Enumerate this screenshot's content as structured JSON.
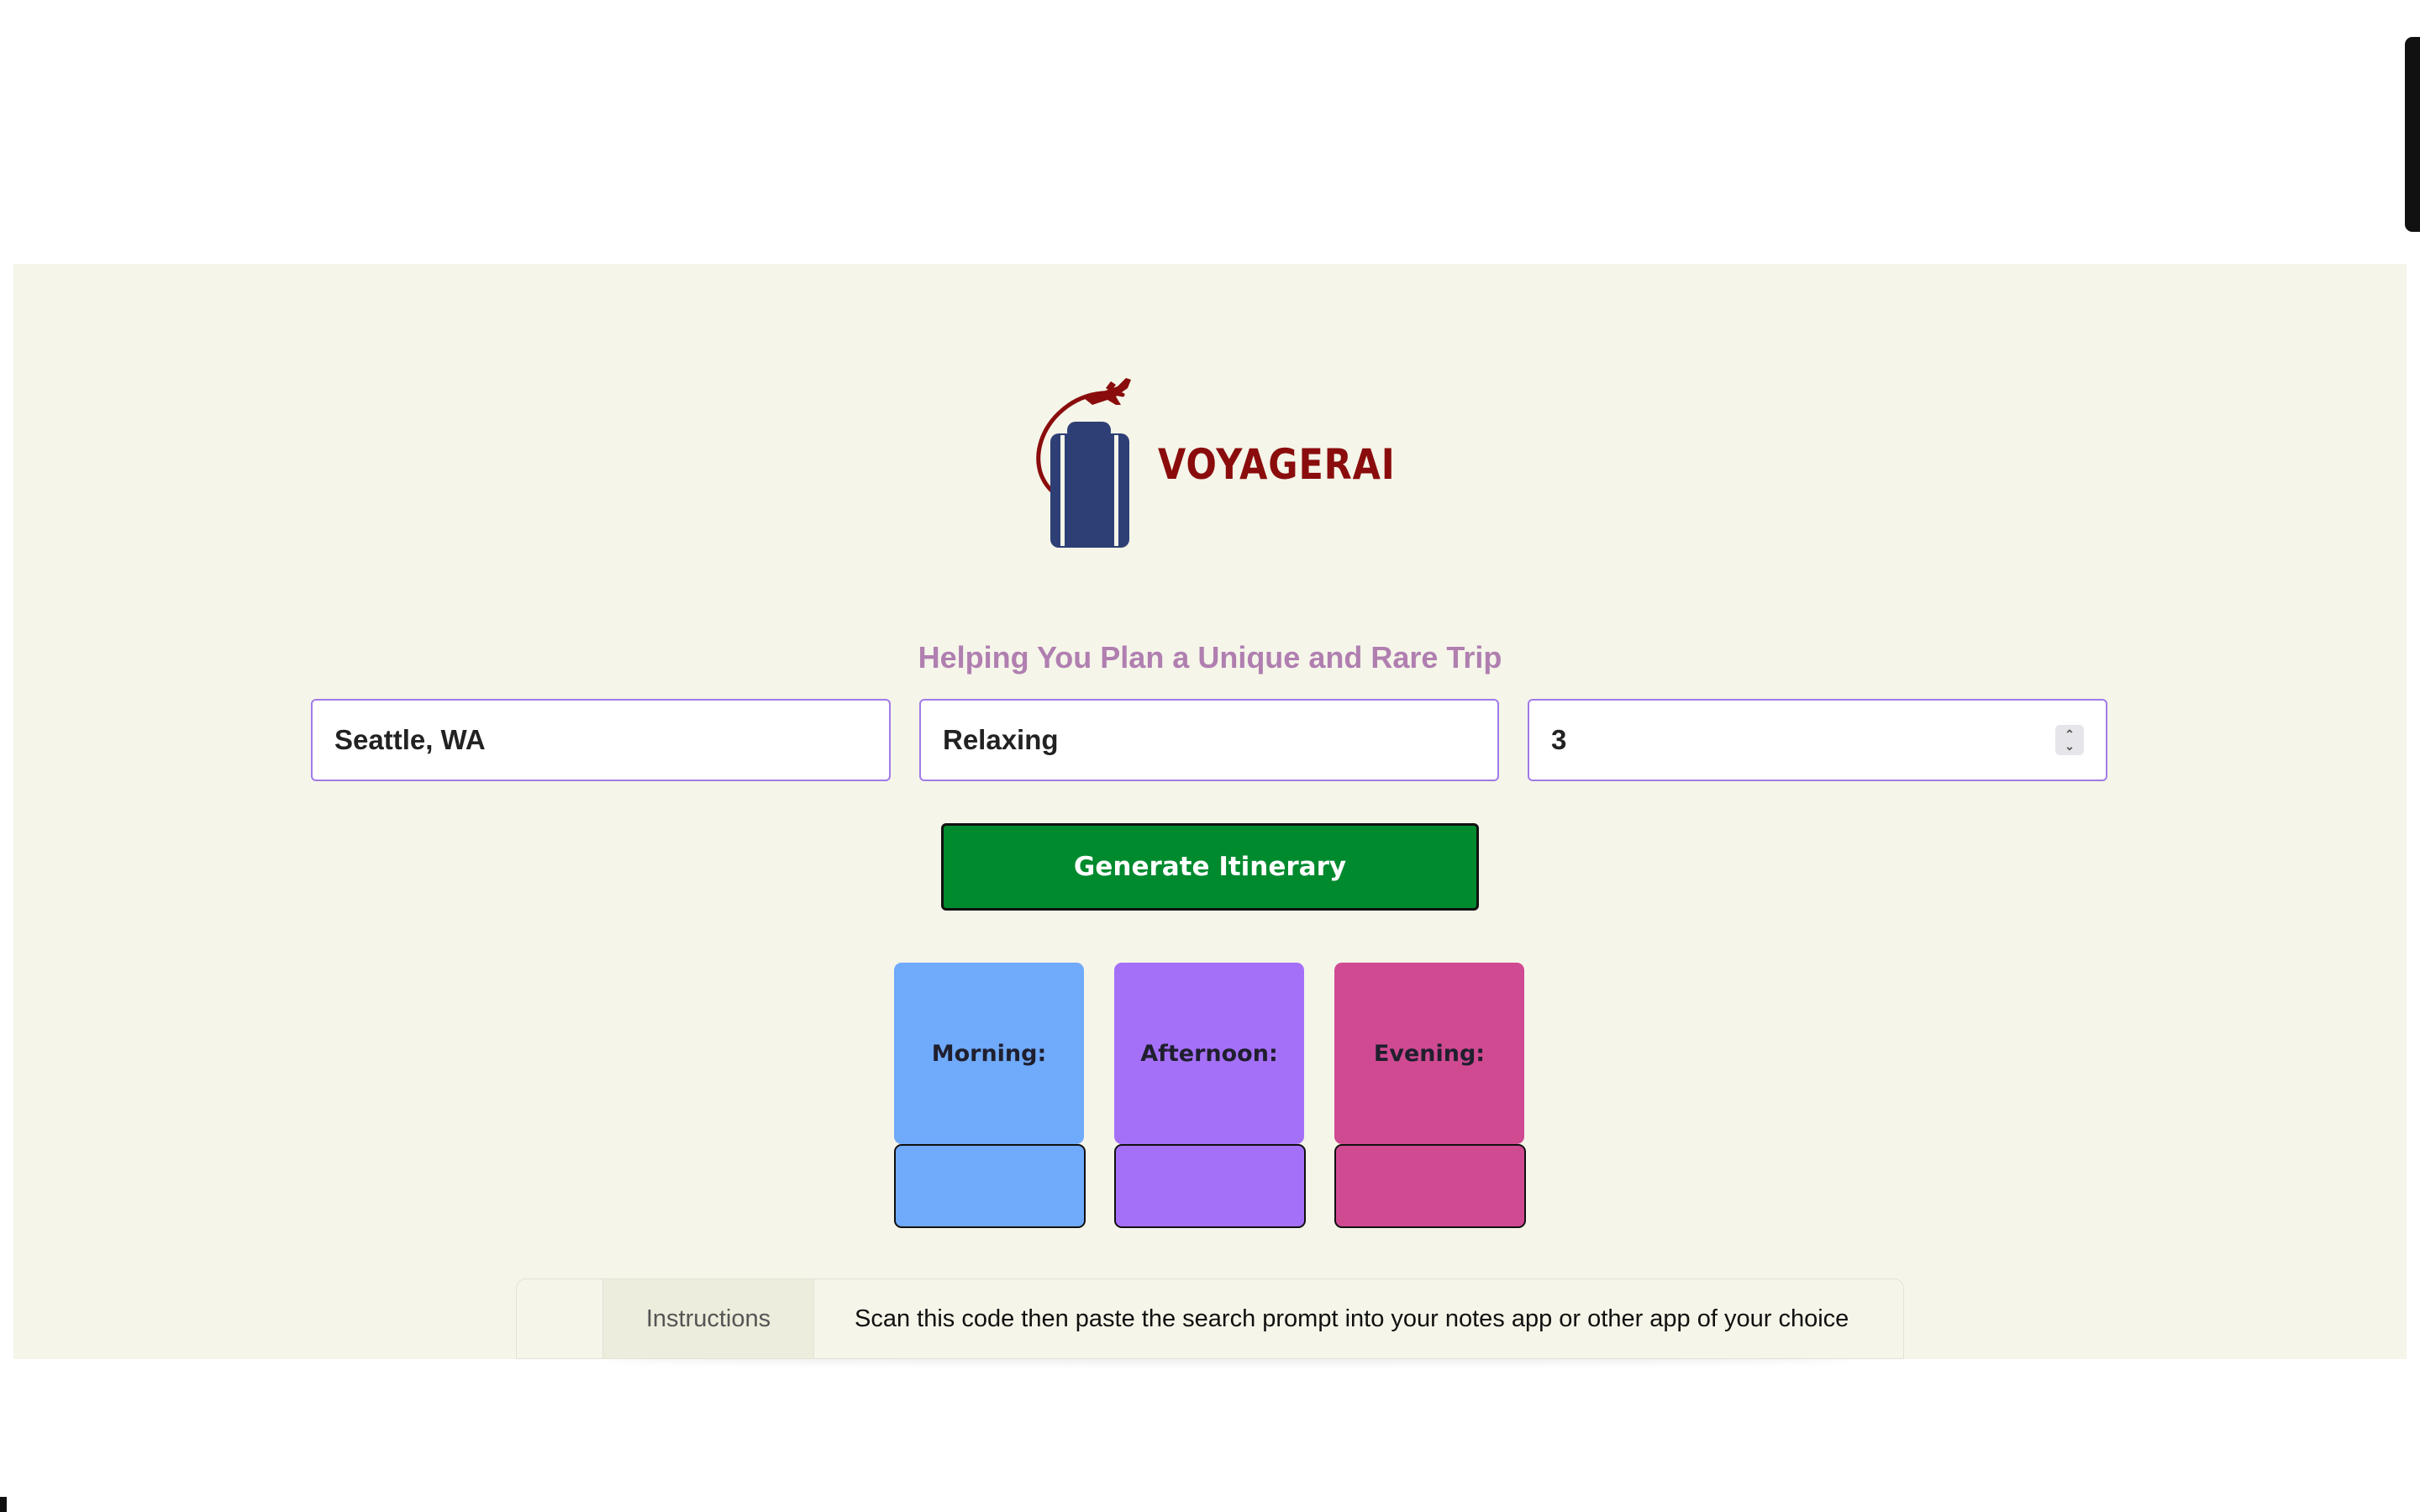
{
  "app": {
    "logo_text": "VOYAGERAI",
    "tagline": "Helping You Plan a Unique and Rare Trip"
  },
  "form": {
    "location_value": "Seattle, WA",
    "mood_value": "Relaxing",
    "days_value": "3",
    "generate_label": "Generate Itinerary"
  },
  "schedule": {
    "morning_label": "Morning:",
    "afternoon_label": "Afternoon:",
    "evening_label": "Evening:"
  },
  "instructions": {
    "tab_label": "Instructions",
    "text": "Scan this code then paste the search prompt into your notes app or other app of your choice"
  },
  "colors": {
    "panel_bg": "#f5f5e9",
    "brand_red": "#8a0c0c",
    "suitcase_blue": "#2e3f75",
    "tagline": "#b07fb0",
    "input_border": "#a17be8",
    "button_green": "#008a2e",
    "morning": "#70aafb",
    "afternoon": "#a570f8",
    "evening": "#d04a92"
  },
  "icons": {
    "logo": "suitcase-airplane-icon",
    "spinner": "number-spinner-icon"
  }
}
